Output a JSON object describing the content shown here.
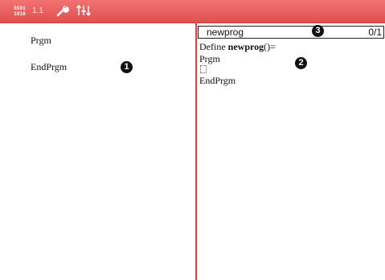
{
  "toolbar": {
    "doc_icon_top": "0101",
    "doc_icon_bottom": "1010",
    "page_label": "1.1"
  },
  "left_pane": {
    "lines": [
      "Prgm",
      "EndPrgm"
    ],
    "marker": "1"
  },
  "right_pane": {
    "program_name": "newprog",
    "line_count": "0/1",
    "name_marker": "3",
    "define_prefix": "Define ",
    "define_name": "newprog",
    "define_suffix": "()=",
    "lines": [
      "Prgm",
      "EndPrgm"
    ],
    "marker": "2"
  },
  "colors": {
    "toolbar": "#e85b5b",
    "divider": "#e3403f"
  }
}
